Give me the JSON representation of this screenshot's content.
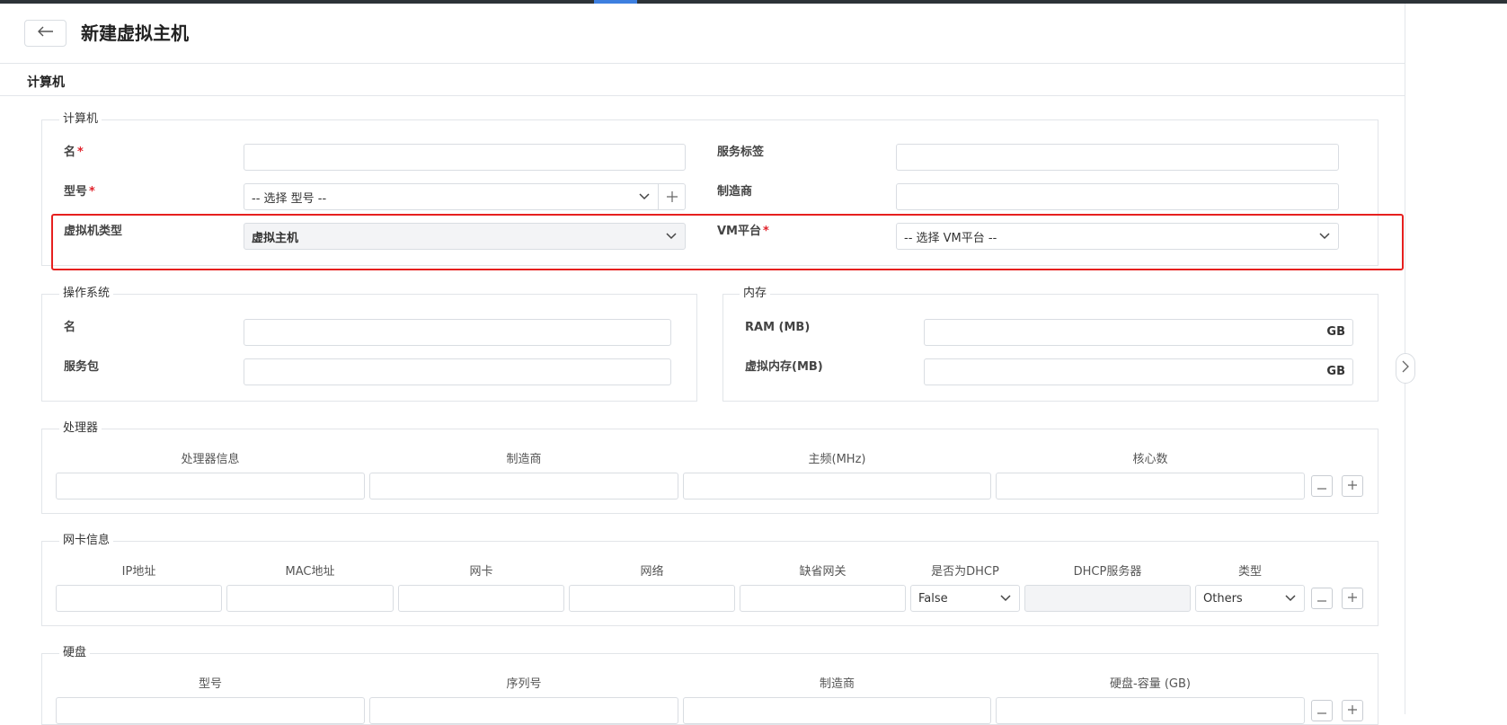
{
  "header": {
    "title": "新建虚拟主机"
  },
  "section": {
    "title": "计算机"
  },
  "computer": {
    "legend": "计算机",
    "name_label": "名",
    "required_mark": "*",
    "service_tag_label": "服务标签",
    "model_label": "型号",
    "model_placeholder": "-- 选择 型号 --",
    "manufacturer_label": "制造商",
    "vm_type_label": "虚拟机类型",
    "vm_type_value": "虚拟主机",
    "vm_platform_label": "VM平台",
    "vm_platform_placeholder": "-- 选择 VM平台 --"
  },
  "os": {
    "legend": "操作系统",
    "name_label": "名",
    "service_pack_label": "服务包"
  },
  "memory": {
    "legend": "内存",
    "ram_label": "RAM (MB)",
    "virtual_label": "虚拟内存(MB)",
    "unit": "GB"
  },
  "processor": {
    "legend": "处理器",
    "columns": [
      "处理器信息",
      "制造商",
      "主频(MHz)",
      "核心数"
    ]
  },
  "nic": {
    "legend": "网卡信息",
    "columns": [
      "IP地址",
      "MAC地址",
      "网卡",
      "网络",
      "缺省网关",
      "是否为DHCP",
      "DHCP服务器",
      "类型"
    ],
    "dhcp_value": "False",
    "type_value": "Others"
  },
  "disk": {
    "legend": "硬盘",
    "columns": [
      "型号",
      "序列号",
      "制造商",
      "硬盘-容量 (GB)"
    ]
  },
  "icons": {
    "back": "arrow-left-icon",
    "chevron": "chevron-down-icon",
    "plus": "plus-icon",
    "minus": "minus-icon",
    "side_toggle": "chevron-right-icon"
  },
  "colors": {
    "accent": "#3d7fe0",
    "required": "#e0222b",
    "highlight_border": "#e6201f",
    "top_bar": "#2d3338"
  }
}
